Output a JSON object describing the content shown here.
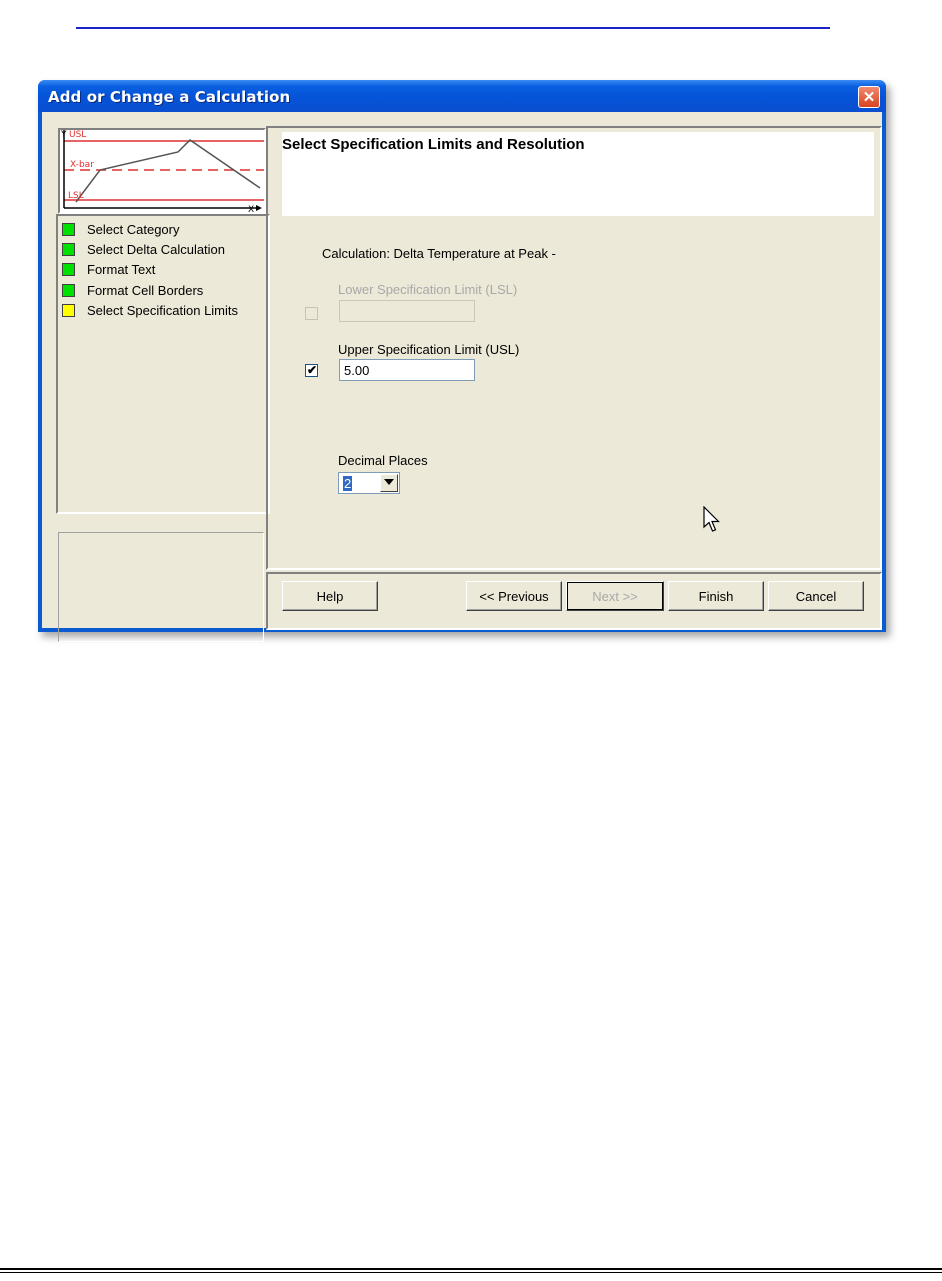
{
  "dialog": {
    "title": "Add or Change a Calculation",
    "close_icon": "close-icon"
  },
  "preview_chart": {
    "y_axis_label": "Y",
    "x_axis_label": "X",
    "usl_label": "USL",
    "xbar_label": "X-bar",
    "lsl_label": "LSL",
    "colors": {
      "limit_line": "#e03030",
      "data_line": "#555555"
    }
  },
  "steps": [
    {
      "label": "Select Category",
      "status_color": "#00e000"
    },
    {
      "label": "Select Delta Calculation",
      "status_color": "#00e000"
    },
    {
      "label": "Format Text",
      "status_color": "#00e000"
    },
    {
      "label": "Format Cell Borders",
      "status_color": "#00e000"
    },
    {
      "label": "Select Specification Limits",
      "status_color": "#ffff00"
    }
  ],
  "page": {
    "header_title": "Select Specification Limits and Resolution",
    "calculation_label": "Calculation: Delta Temperature at Peak -",
    "lsl": {
      "label": "Lower Specification Limit (LSL)",
      "checked": false,
      "enabled": false,
      "value": ""
    },
    "usl": {
      "label": "Upper Specification Limit (USL)",
      "checked": true,
      "enabled": true,
      "value": "5.00"
    },
    "decimal_places": {
      "label": "Decimal Places",
      "value": "2"
    }
  },
  "buttons": {
    "help": "Help",
    "previous": "<< Previous",
    "next": "Next >>",
    "finish": "Finish",
    "cancel": "Cancel"
  }
}
